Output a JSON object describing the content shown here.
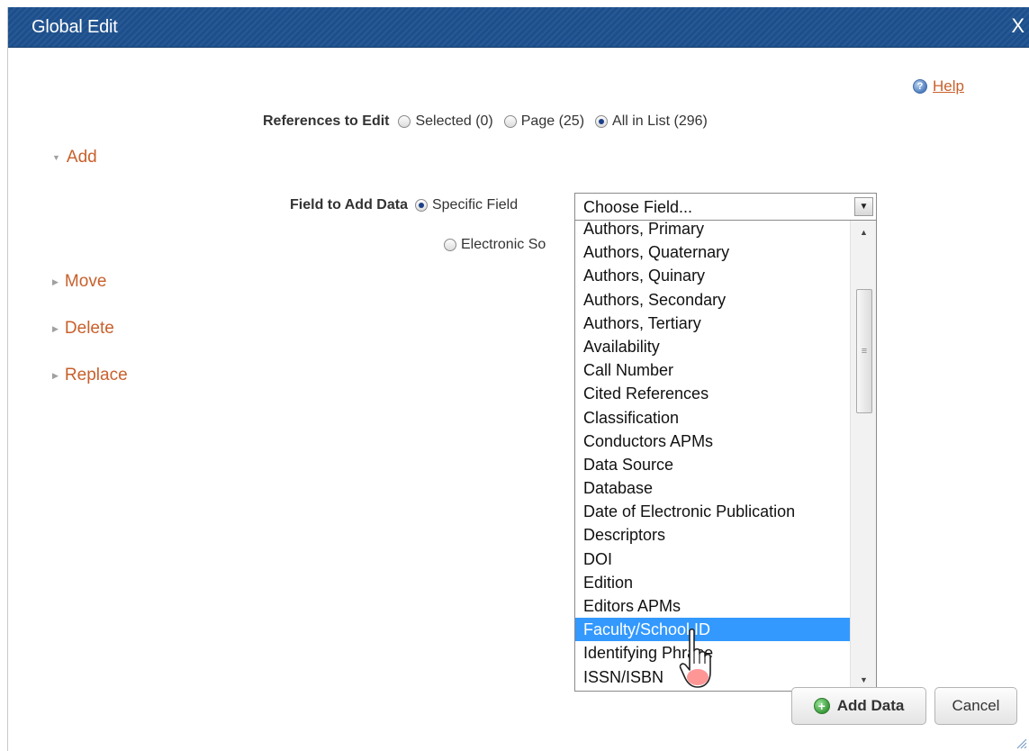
{
  "dialog": {
    "title": "Global Edit",
    "close_label": "X",
    "help_label": "Help"
  },
  "references": {
    "label": "References to Edit",
    "options": [
      "Selected (0)",
      "Page (25)",
      "All in List (296)"
    ],
    "selected": "All in List (296)"
  },
  "sections": {
    "add": "Add",
    "move": "Move",
    "delete": "Delete",
    "replace": "Replace"
  },
  "field_to_add": {
    "label": "Field to Add Data",
    "specific_label": "Specific Field",
    "electronic_label": "Electronic So",
    "select_value": "Choose Field..."
  },
  "dropdown": {
    "items": [
      "Authors, Primary",
      "Authors, Quaternary",
      "Authors, Quinary",
      "Authors, Secondary",
      "Authors, Tertiary",
      "Availability",
      "Call Number",
      "Cited References",
      "Classification",
      "Conductors APMs",
      "Data Source",
      "Database",
      "Date of Electronic Publication",
      "Descriptors",
      "DOI",
      "Edition",
      "Editors APMs",
      "Faculty/School ID",
      "Identifying Phrase",
      "ISSN/ISBN"
    ],
    "highlighted": "Faculty/School ID"
  },
  "buttons": {
    "add_data": "Add Data",
    "cancel": "Cancel"
  },
  "colors": {
    "titlebar": "#1c4f8c",
    "link": "#c8602c",
    "highlight": "#3399ff"
  }
}
